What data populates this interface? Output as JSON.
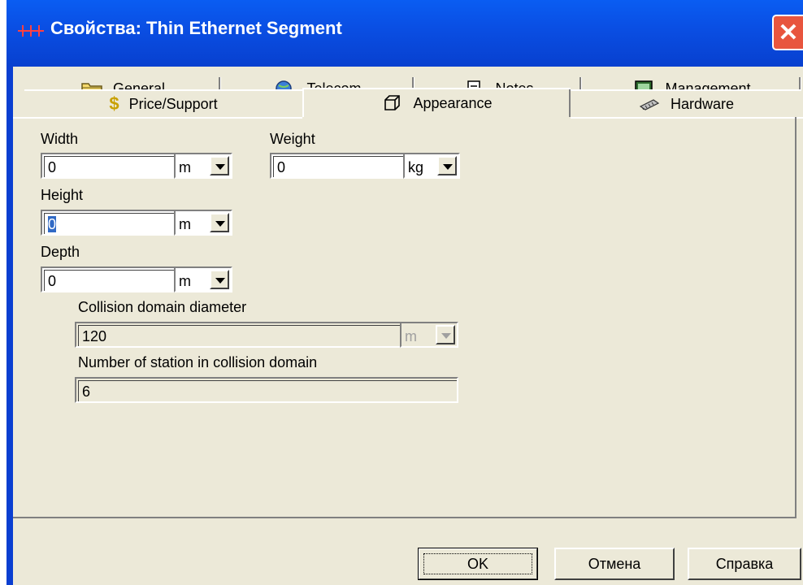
{
  "window": {
    "title": "Свойства: Thin Ethernet Segment",
    "close_glyph": "✕"
  },
  "tabs_row1": [
    {
      "label": "General",
      "icon": "folder-icon"
    },
    {
      "label": "Telecom",
      "icon": "globe-phone-icon"
    },
    {
      "label": "Notes",
      "icon": "notes-icon"
    },
    {
      "label": "Management",
      "icon": "monitor-icon"
    }
  ],
  "tabs_row2": [
    {
      "label": "Price/Support",
      "icon": "dollar-icon"
    },
    {
      "label": "Appearance",
      "icon": "cube-icon",
      "selected": true
    },
    {
      "label": "Hardware",
      "icon": "chip-icon"
    }
  ],
  "form": {
    "width": {
      "label": "Width",
      "value": "0",
      "unit": "m"
    },
    "weight": {
      "label": "Weight",
      "value": "0",
      "unit": "kg"
    },
    "height": {
      "label": "Height",
      "value": "0",
      "unit": "m"
    },
    "depth": {
      "label": "Depth",
      "value": "0",
      "unit": "m"
    },
    "collision_diameter": {
      "label": "Collision domain diameter",
      "value": "120",
      "unit": "m"
    },
    "stations": {
      "label": "Number of station in collision domain",
      "value": "6"
    }
  },
  "buttons": {
    "ok": "OK",
    "cancel": "Отмена",
    "help": "Справка"
  }
}
